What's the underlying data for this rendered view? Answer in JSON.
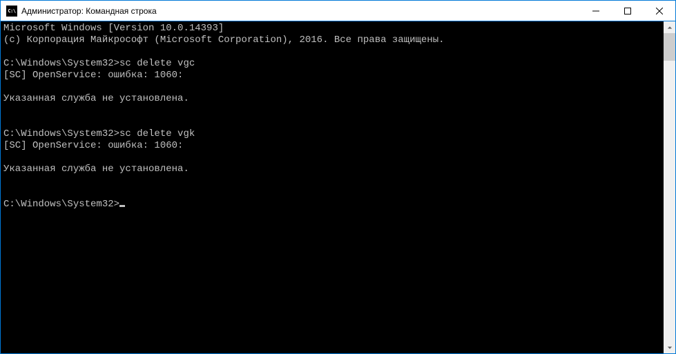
{
  "titlebar": {
    "icon_text": "C:\\",
    "title": "Администратор: Командная строка"
  },
  "console": {
    "lines": [
      "Microsoft Windows [Version 10.0.14393]",
      "(c) Корпорация Майкрософт (Microsoft Corporation), 2016. Все права защищены.",
      "",
      "C:\\Windows\\System32>sc delete vgc",
      "[SC] OpenService: ошибка: 1060:",
      "",
      "Указанная служба не установлена.",
      "",
      "",
      "C:\\Windows\\System32>sc delete vgk",
      "[SC] OpenService: ошибка: 1060:",
      "",
      "Указанная служба не установлена.",
      "",
      "",
      "C:\\Windows\\System32>"
    ]
  }
}
